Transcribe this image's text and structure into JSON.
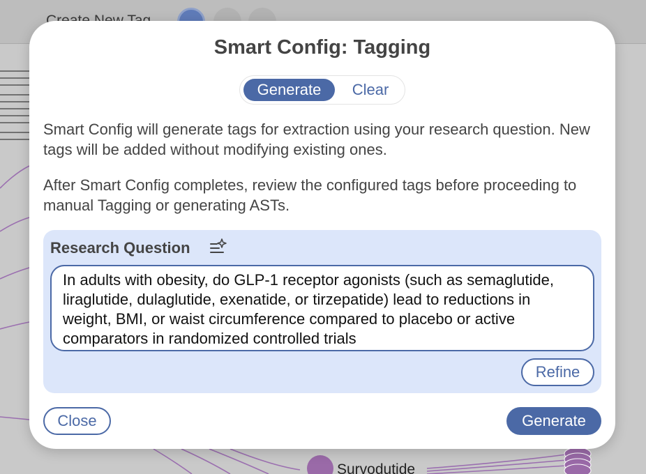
{
  "background": {
    "create_tag_label": "Create New Tag",
    "node_label": "Survodutide",
    "edge_color": "#9b6fb0",
    "node_color": "#9a6aa8"
  },
  "modal": {
    "title": "Smart Config: Tagging",
    "tabs": [
      {
        "label": "Generate",
        "selected": true
      },
      {
        "label": "Clear",
        "selected": false
      }
    ],
    "description_1": "Smart Config will generate tags for extraction using your research question. New tags will be added without modifying existing ones.",
    "description_2": "After Smart Config completes, review the configured tags before proceeding to manual Tagging or generating ASTs.",
    "research_question": {
      "label": "Research Question",
      "icon": "sparkle-list-icon",
      "value": "In adults with obesity, do GLP-1 receptor agonists (such as semaglutide, liraglutide, dulaglutide, exenatide, or tirzepatide) lead to reductions in weight, BMI, or waist circumference compared to placebo or active comparators in randomized controlled trials",
      "refine_label": "Refine"
    },
    "close_label": "Close",
    "generate_label": "Generate"
  },
  "colors": {
    "accent": "#4b69a6",
    "panel": "#dce6fa",
    "text": "#444444"
  }
}
